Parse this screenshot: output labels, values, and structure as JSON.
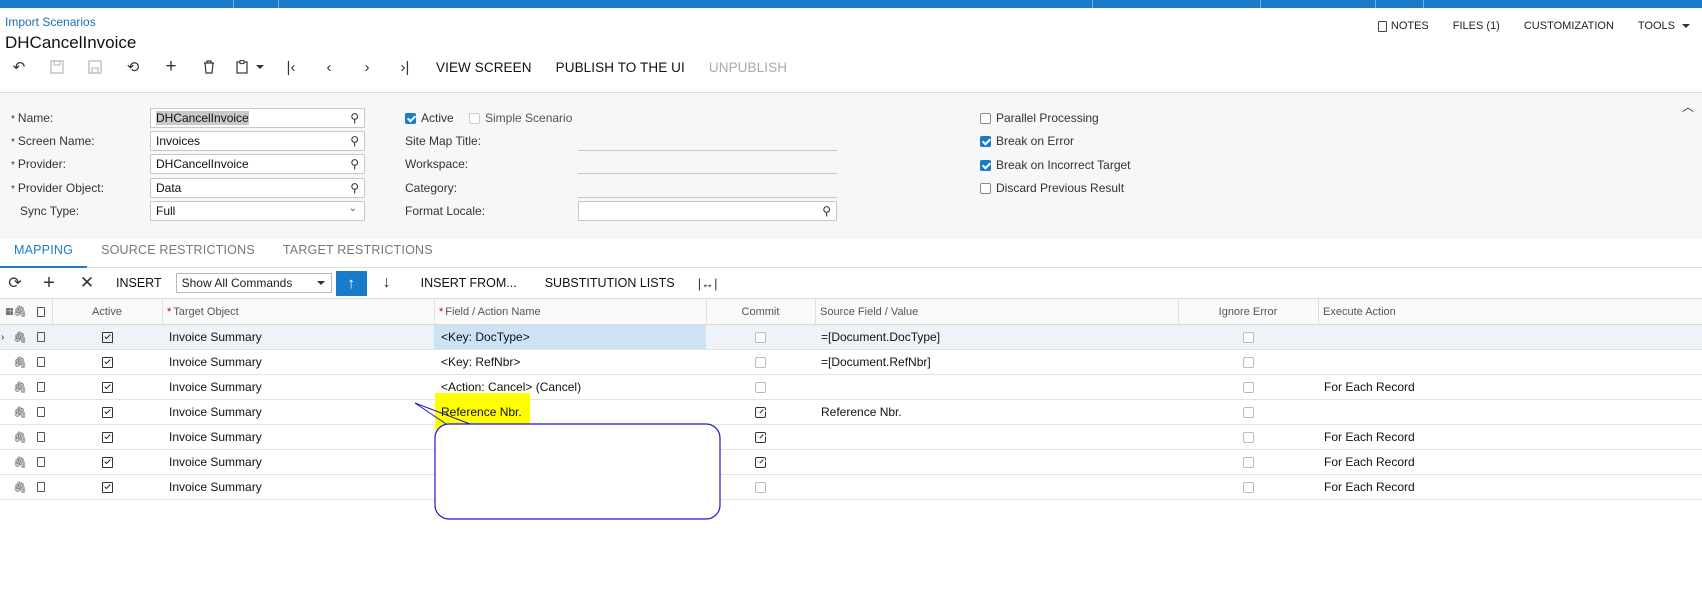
{
  "breadcrumb": "Import Scenarios",
  "page_title": "DHCancelInvoice",
  "header_actions": {
    "notes": "NOTES",
    "files": "FILES (1)",
    "customization": "CUSTOMIZATION",
    "tools": "TOOLS"
  },
  "toolbar": {
    "view_screen": "VIEW SCREEN",
    "publish": "PUBLISH TO THE UI",
    "unpublish": "UNPUBLISH"
  },
  "form": {
    "name_label": "Name:",
    "name_value": "DHCancelInvoice",
    "screen_name_label": "Screen Name:",
    "screen_name_value": "Invoices",
    "provider_label": "Provider:",
    "provider_value": "DHCancelInvoice",
    "provider_object_label": "Provider Object:",
    "provider_object_value": "Data",
    "sync_type_label": "Sync Type:",
    "sync_type_value": "Full",
    "active_label": "Active",
    "simple_scenario_label": "Simple Scenario",
    "site_map_title_label": "Site Map Title:",
    "workspace_label": "Workspace:",
    "category_label": "Category:",
    "format_locale_label": "Format Locale:",
    "parallel_processing_label": "Parallel Processing",
    "break_on_error_label": "Break on Error",
    "break_on_incorrect_target_label": "Break on Incorrect Target",
    "discard_previous_result_label": "Discard Previous Result"
  },
  "tabs": [
    "MAPPING",
    "SOURCE RESTRICTIONS",
    "TARGET RESTRICTIONS"
  ],
  "grid_toolbar": {
    "insert": "INSERT",
    "command_filter": "Show All Commands",
    "insert_from": "INSERT FROM...",
    "substitution_lists": "SUBSTITUTION LISTS"
  },
  "columns": {
    "active": "Active",
    "target_object": "Target Object",
    "field_action": "Field / Action Name",
    "commit": "Commit",
    "source_field": "Source Field / Value",
    "ignore_error": "Ignore Error",
    "execute_action": "Execute Action"
  },
  "rows": [
    {
      "target": "Invoice Summary",
      "field": "<Key: DocType>",
      "commit": false,
      "source": "=[Document.DocType]",
      "execute": ""
    },
    {
      "target": "Invoice Summary",
      "field": "<Key: RefNbr>",
      "commit": false,
      "source": "=[Document.RefNbr]",
      "execute": ""
    },
    {
      "target": "Invoice Summary",
      "field": "<Action: Cancel> (Cancel)",
      "commit": false,
      "source": "",
      "execute": "For Each Record"
    },
    {
      "target": "Invoice Summary",
      "field": "Reference Nbr.",
      "commit": true,
      "source": "Reference Nbr.",
      "execute": ""
    },
    {
      "target": "Invoice Summary",
      "field": "",
      "commit": true,
      "source": "",
      "execute": "For Each Record"
    },
    {
      "target": "Invoice Summary",
      "field": "",
      "commit": true,
      "source": "",
      "execute": "For Each Record"
    },
    {
      "target": "Invoice Summary",
      "field": "",
      "commit": false,
      "source": "",
      "execute": "For Each Record"
    }
  ],
  "colors": {
    "accent": "#1a7cc8",
    "highlight": "#ffff00",
    "callout_border": "#1a1ac8"
  }
}
